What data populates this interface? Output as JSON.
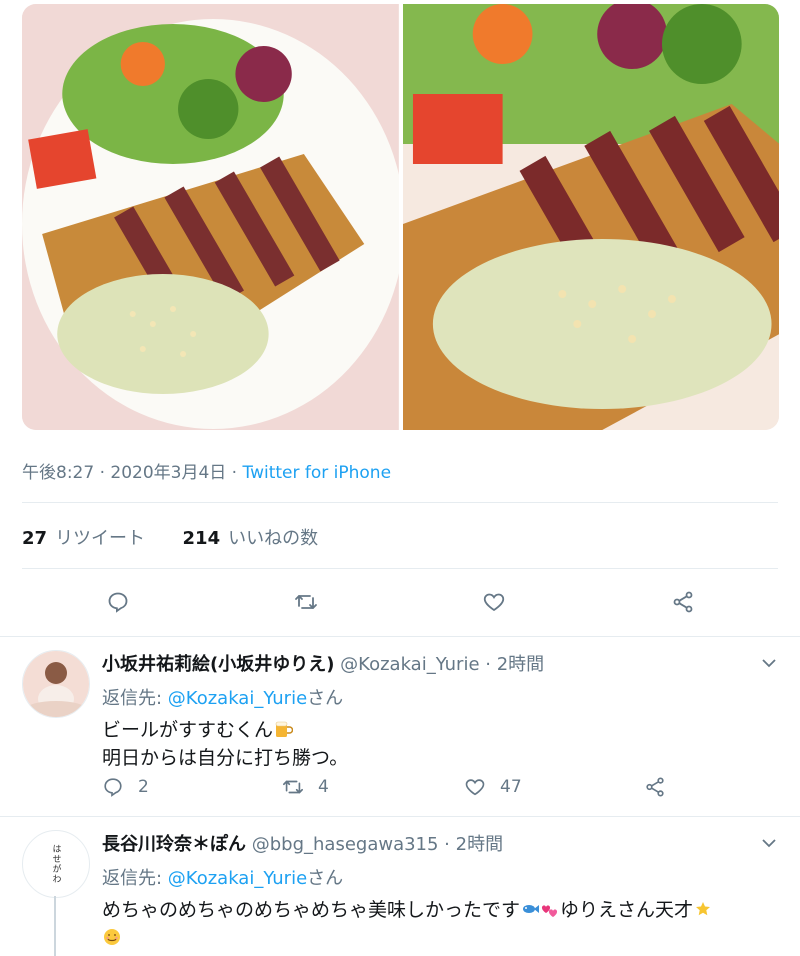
{
  "media": {
    "photos": [
      {
        "name": "tuna-katsu-photo-1"
      },
      {
        "name": "tuna-katsu-photo-2"
      }
    ]
  },
  "tweet": {
    "time": "午後8:27 · 2020年3月4日 · ",
    "source": "Twitter for iPhone",
    "retweets_count": "27",
    "retweets_label": "リツイート",
    "likes_count": "214",
    "likes_label": "いいねの数"
  },
  "actions": {
    "icons": [
      "reply-icon",
      "retweet-icon",
      "like-icon",
      "share-icon"
    ]
  },
  "replies": [
    {
      "name": "小坂井祐莉絵(小坂井ゆりえ)",
      "handle": " @Kozakai_Yurie · 2時間",
      "reply_to_label": "返信先: ",
      "reply_to_mention": "@Kozakai_Yurie",
      "reply_to_suffix": "さん",
      "text_line1": "ビールがすすむくん",
      "text_line2": "明日からは自分に打ち勝つ。",
      "reply_count": "2",
      "retweet_count": "4",
      "like_count": "47"
    },
    {
      "name": "長谷川玲奈＊ぽん",
      "handle": " @bbg_hasegawa315 · 2時間",
      "reply_to_label": "返信先: ",
      "reply_to_mention": "@Kozakai_Yurie",
      "reply_to_suffix": "さん",
      "text_line1": "めちゃのめちゃのめちゃめちゃ美味しかったです",
      "text_line1b": "ゆりえさん天才",
      "avatar_text": "はせがわ"
    }
  ],
  "colors": {
    "accent": "#1da1f2",
    "muted": "#657786",
    "divider": "#e6ecf0"
  }
}
